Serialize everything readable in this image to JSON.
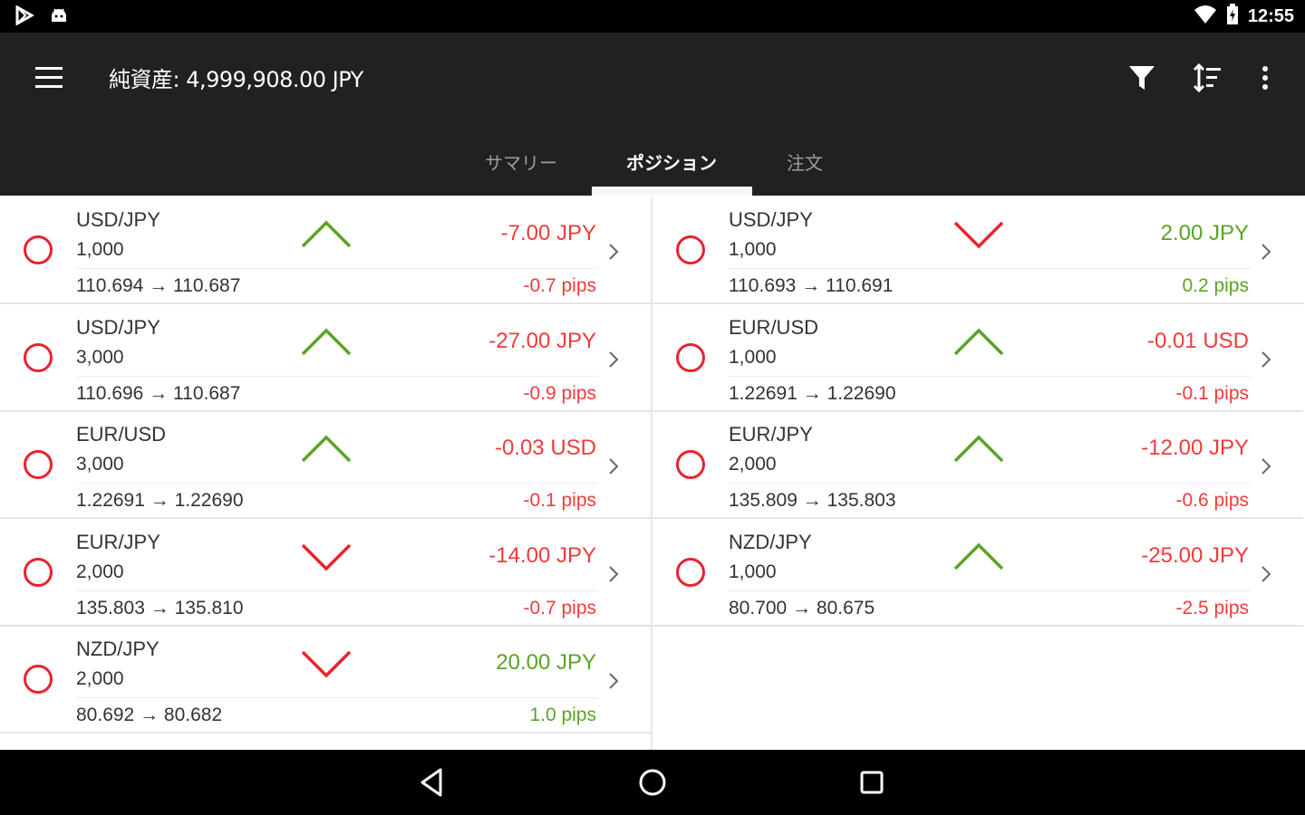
{
  "status_bar": {
    "time": "12:55",
    "icons": [
      "play-store-icon",
      "android-icon",
      "wifi-icon",
      "battery-icon"
    ]
  },
  "app_bar": {
    "title": "純資産: 4,999,908.00 JPY",
    "actions": [
      "filter-icon",
      "sort-icon",
      "more-vert-icon"
    ]
  },
  "tabs": [
    {
      "label": "サマリー",
      "active": false
    },
    {
      "label": "ポジション",
      "active": true
    },
    {
      "label": "注文",
      "active": false
    }
  ],
  "colors": {
    "up": "#5aa424",
    "down": "#e8232d",
    "loss": "#ef3b3b",
    "gain": "#5aa424",
    "app_bar": "#212121"
  },
  "positions": [
    {
      "pair": "USD/JPY",
      "amount": "1,000",
      "open": "110.694",
      "current": "110.687",
      "direction": "up",
      "pl": "-7.00 JPY",
      "pips": "-0.7 pips",
      "sign": "loss"
    },
    {
      "pair": "USD/JPY",
      "amount": "1,000",
      "open": "110.693",
      "current": "110.691",
      "direction": "down",
      "pl": "2.00 JPY",
      "pips": "0.2 pips",
      "sign": "gain"
    },
    {
      "pair": "USD/JPY",
      "amount": "3,000",
      "open": "110.696",
      "current": "110.687",
      "direction": "up",
      "pl": "-27.00 JPY",
      "pips": "-0.9 pips",
      "sign": "loss"
    },
    {
      "pair": "EUR/USD",
      "amount": "1,000",
      "open": "1.22691",
      "current": "1.22690",
      "direction": "up",
      "pl": "-0.01 USD",
      "pips": "-0.1 pips",
      "sign": "loss"
    },
    {
      "pair": "EUR/USD",
      "amount": "3,000",
      "open": "1.22691",
      "current": "1.22690",
      "direction": "up",
      "pl": "-0.03 USD",
      "pips": "-0.1 pips",
      "sign": "loss"
    },
    {
      "pair": "EUR/JPY",
      "amount": "2,000",
      "open": "135.809",
      "current": "135.803",
      "direction": "up",
      "pl": "-12.00 JPY",
      "pips": "-0.6 pips",
      "sign": "loss"
    },
    {
      "pair": "EUR/JPY",
      "amount": "2,000",
      "open": "135.803",
      "current": "135.810",
      "direction": "down",
      "pl": "-14.00 JPY",
      "pips": "-0.7 pips",
      "sign": "loss"
    },
    {
      "pair": "NZD/JPY",
      "amount": "1,000",
      "open": "80.700",
      "current": "80.675",
      "direction": "up",
      "pl": "-25.00 JPY",
      "pips": "-2.5 pips",
      "sign": "loss"
    },
    {
      "pair": "NZD/JPY",
      "amount": "2,000",
      "open": "80.692",
      "current": "80.682",
      "direction": "down",
      "pl": "20.00 JPY",
      "pips": "1.0 pips",
      "sign": "gain"
    }
  ],
  "nav_bar": [
    "back-icon",
    "home-icon",
    "recents-icon"
  ]
}
